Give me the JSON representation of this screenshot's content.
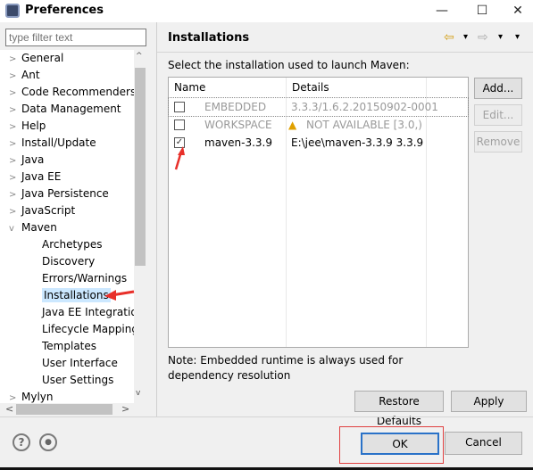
{
  "window": {
    "title": "Preferences",
    "minimize": "—",
    "maximize": "☐",
    "close": "✕"
  },
  "filter": {
    "placeholder": "type filter text"
  },
  "tree": [
    {
      "label": "General",
      "twisty": ">"
    },
    {
      "label": "Ant",
      "twisty": ">"
    },
    {
      "label": "Code Recommenders",
      "twisty": ">"
    },
    {
      "label": "Data Management",
      "twisty": ">"
    },
    {
      "label": "Help",
      "twisty": ">"
    },
    {
      "label": "Install/Update",
      "twisty": ">"
    },
    {
      "label": "Java",
      "twisty": ">"
    },
    {
      "label": "Java EE",
      "twisty": ">"
    },
    {
      "label": "Java Persistence",
      "twisty": ">"
    },
    {
      "label": "JavaScript",
      "twisty": ">"
    },
    {
      "label": "Maven",
      "twisty": "v"
    },
    {
      "label": "Archetypes",
      "twisty": ""
    },
    {
      "label": "Discovery",
      "twisty": ""
    },
    {
      "label": "Errors/Warnings",
      "twisty": ""
    },
    {
      "label": "Installations",
      "twisty": "",
      "selected": true
    },
    {
      "label": "Java EE Integration",
      "twisty": ""
    },
    {
      "label": "Lifecycle Mapping",
      "twisty": ""
    },
    {
      "label": "Templates",
      "twisty": ""
    },
    {
      "label": "User Interface",
      "twisty": ""
    },
    {
      "label": "User Settings",
      "twisty": ""
    },
    {
      "label": "Mylyn",
      "twisty": ">"
    }
  ],
  "page": {
    "title": "Installations",
    "prompt": "Select the installation used to launch Maven:",
    "nav": [
      "⇦",
      "▾",
      "⇨",
      "▾",
      "▾"
    ]
  },
  "table": {
    "columns": [
      "Name",
      "Details"
    ],
    "rows": [
      {
        "checked": false,
        "name": "EMBEDDED",
        "details": "3.3.3/1.6.2.20150902-0001",
        "disabled": true
      },
      {
        "checked": false,
        "name": "WORKSPACE",
        "details": "NOT AVAILABLE [3.0,)",
        "warning": true,
        "disabled": true
      },
      {
        "checked": true,
        "name": "maven-3.3.9",
        "details": "E:\\jee\\maven-3.3.9 3.3.9",
        "disabled": false
      }
    ]
  },
  "buttons": {
    "add": "Add...",
    "edit": "Edit...",
    "remove": "Remove",
    "restore": "Restore Defaults",
    "apply": "Apply",
    "ok": "OK",
    "cancel": "Cancel"
  },
  "note": "Note: Embedded runtime is always used for dependency resolution",
  "footer": {
    "help": "?",
    "other": "●"
  },
  "annotation_color": "#e8302a"
}
